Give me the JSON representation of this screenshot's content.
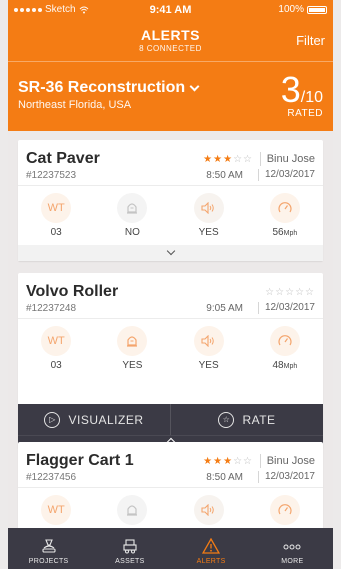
{
  "status_bar": {
    "carrier": "Sketch",
    "time": "9:41 AM",
    "battery": "100%"
  },
  "nav": {
    "title": "ALERTS",
    "subtitle": "8 CONNECTED",
    "filter_label": "Filter"
  },
  "project": {
    "name": "SR-36 Reconstruction",
    "location": "Northeast Florida, USA",
    "rated_count": "3",
    "rated_total": "/10",
    "rated_label": "RATED"
  },
  "metric_labels": [
    "WT",
    "",
    "",
    ""
  ],
  "cards": [
    {
      "name": "Cat Paver",
      "id": "#12237523",
      "rating": 3,
      "stars_total": 5,
      "owner": "Binu Jose",
      "time": "8:50 AM",
      "date": "12/03/2017",
      "metrics": {
        "wt": "03",
        "beacon": "NO",
        "sound": "YES",
        "speed": "56",
        "speed_unit": "Mph"
      }
    },
    {
      "name": "Volvo Roller",
      "id": "#12237248",
      "rating": 0,
      "stars_total": 5,
      "owner": "",
      "time": "9:05 AM",
      "date": "12/03/2017",
      "metrics": {
        "wt": "03",
        "beacon": "YES",
        "sound": "YES",
        "speed": "48",
        "speed_unit": "Mph"
      },
      "actions": {
        "visualizer": "VISUALIZER",
        "rate": "RATE"
      }
    },
    {
      "name": "Flagger Cart 1",
      "id": "#12237456",
      "rating": 3,
      "stars_total": 5,
      "owner": "Binu Jose",
      "time": "8:50 AM",
      "date": "12/03/2017"
    }
  ],
  "tabs": [
    {
      "label": "PROJECTS",
      "icon": "projects-icon",
      "active": false
    },
    {
      "label": "ASSETS",
      "icon": "assets-icon",
      "active": false
    },
    {
      "label": "ALERTS",
      "icon": "alert-triangle-icon",
      "active": true
    },
    {
      "label": "MORE",
      "icon": "more-dots-icon",
      "active": false
    }
  ],
  "colors": {
    "accent": "#f47c14",
    "dark": "#3b3a45",
    "background": "#ece9e9"
  }
}
